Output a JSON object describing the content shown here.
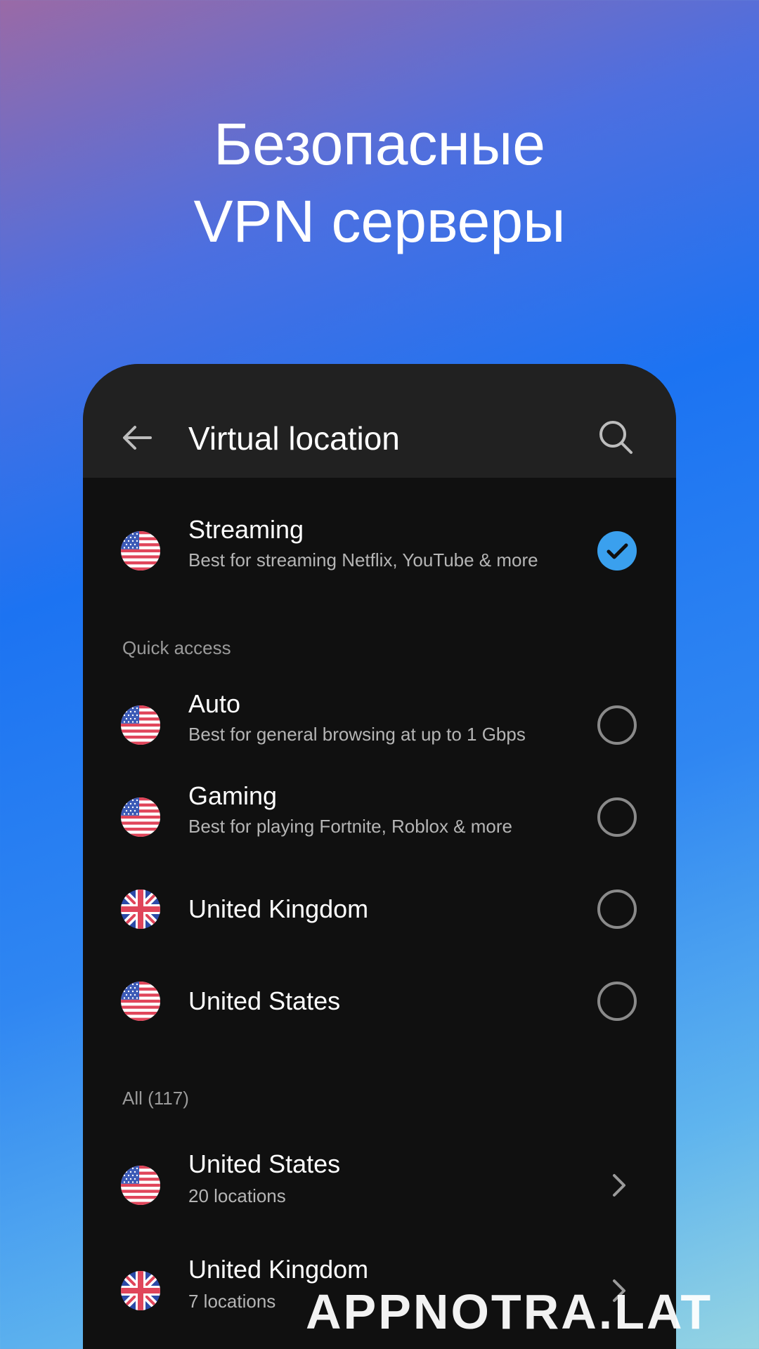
{
  "promo": {
    "line1": "Безопасные",
    "line2": "VPN серверы"
  },
  "appbar": {
    "title": "Virtual location",
    "back_icon": "arrow-left-icon",
    "search_icon": "search-icon"
  },
  "selected": {
    "title": "Streaming",
    "subtitle": "Best for streaming Netflix, YouTube & more",
    "flag": "us",
    "state": "checked"
  },
  "quick_access": {
    "header": "Quick access",
    "items": [
      {
        "title": "Auto",
        "subtitle": "Best for general browsing at up to 1 Gbps",
        "flag": "us",
        "state": "unchecked"
      },
      {
        "title": "Gaming",
        "subtitle": "Best for playing Fortnite, Roblox & more",
        "flag": "us",
        "state": "unchecked"
      },
      {
        "title": "United Kingdom",
        "flag": "uk",
        "state": "unchecked"
      },
      {
        "title": "United States",
        "flag": "us",
        "state": "unchecked"
      }
    ]
  },
  "all": {
    "header": "All (117)",
    "items": [
      {
        "title": "United States",
        "subtitle": "20 locations",
        "flag": "us"
      },
      {
        "title": "United Kingdom",
        "subtitle": "7 locations",
        "flag": "uk"
      }
    ]
  },
  "colors": {
    "accent": "#3aa0ee",
    "surface": "#101010",
    "appbar": "#212121"
  },
  "watermark": "APPNOTRA.LAT"
}
